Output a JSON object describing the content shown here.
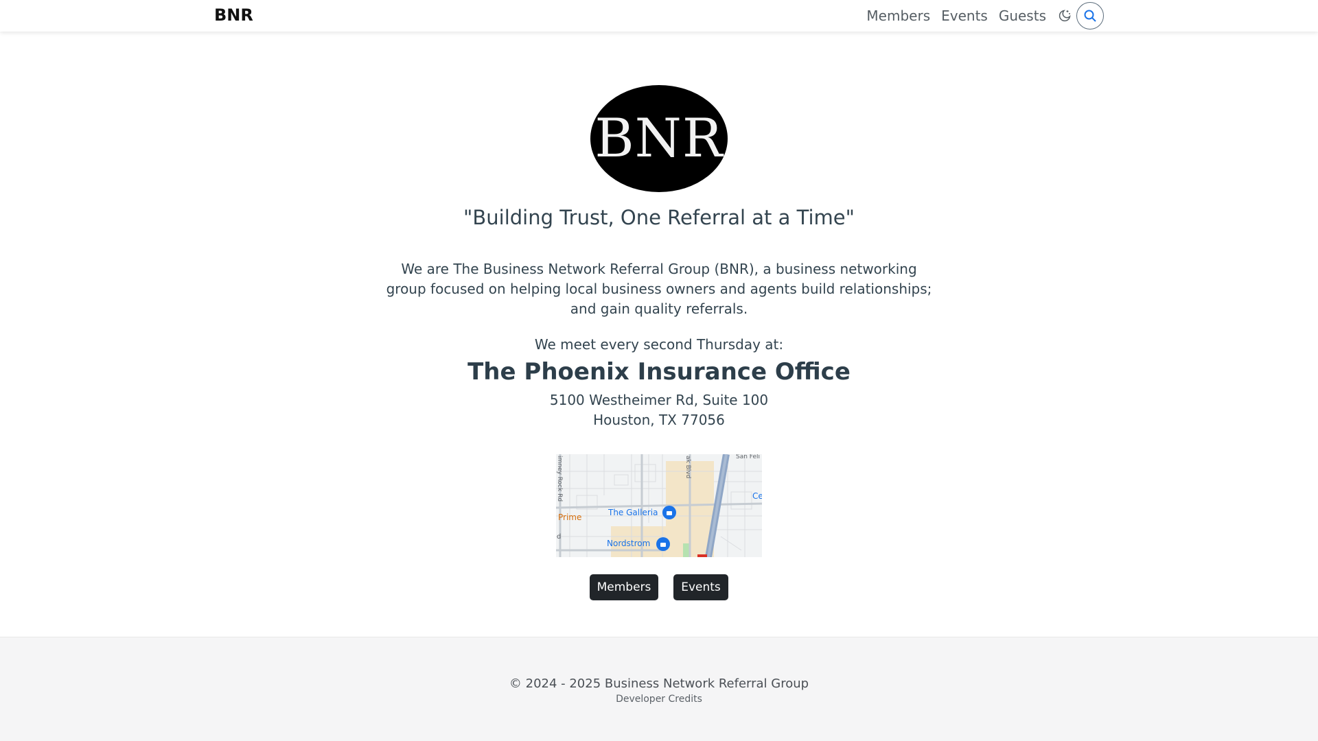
{
  "header": {
    "brand": "BNR",
    "nav": [
      "Members",
      "Events",
      "Guests"
    ],
    "theme_icon": "moon-stars-icon",
    "search_icon": "search-icon"
  },
  "hero": {
    "logo_text": "BNR",
    "slogan": "\"Building Trust, One Referral at a Time\"",
    "intro": "We are The Business Network Referral Group (BNR), a business networking group focused on helping local business owners and agents build relationships; and gain quality referrals.",
    "meet_label": "We meet every second Thursday at:",
    "venue": "The Phoenix Insurance Office",
    "address_line1": "5100 Westheimer Rd, Suite 100",
    "address_line2": "Houston, TX 77056"
  },
  "map": {
    "labels": {
      "galleria": "The Galleria",
      "nordstrom": "Nordstrom",
      "prime": "Prime",
      "chimney_rock": "imney Rock Rd",
      "post_oak": "ak Blvd",
      "san_felipe": "San Feli",
      "ce": "Ce",
      "edge_d": "d"
    }
  },
  "actions": {
    "members": "Members",
    "events": "Events"
  },
  "footer": {
    "copyright": "© 2024 - 2025 Business Network Referral Group",
    "credits": "Developer Credits"
  },
  "colors": {
    "accent_blue": "#1a73e8",
    "text": "#33444f",
    "button_dark": "#212529"
  }
}
